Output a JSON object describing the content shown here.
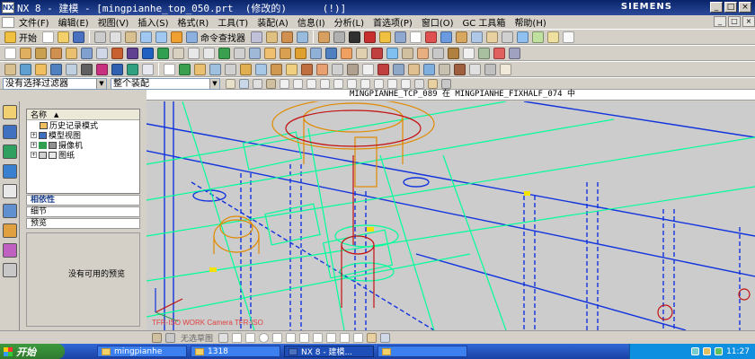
{
  "window": {
    "title": "NX 8 - 建模 - [mingpianhe_top_050.prt  (修改的)      (!)]",
    "brand": "SIEMENS",
    "minimize": "_",
    "restore": "□",
    "close": "×"
  },
  "menu": [
    "文件(F)",
    "编辑(E)",
    "视图(V)",
    "插入(S)",
    "格式(R)",
    "工具(T)",
    "装配(A)",
    "信息(I)",
    "分析(L)",
    "首选项(P)",
    "窗口(O)",
    "GC 工具箱",
    "帮助(H)"
  ],
  "toolbar1": {
    "start_label": "开始",
    "command_finder_label": "命令查找器"
  },
  "filter_bar": {
    "selection_filter": "没有选择过滤器",
    "scope": "整个装配"
  },
  "graphics": {
    "work_part_label": "MINGPIANHE_TCP_089 在 MINGPIANHE_FIXHALF_074 中",
    "view_triad_text": "TFR-ISO WORK Camera TFR-ISO"
  },
  "navigator": {
    "column_header": "名称",
    "nodes": [
      {
        "label": "历史记录模式"
      },
      {
        "label": "模型视图"
      },
      {
        "label": "摄像机"
      },
      {
        "label": "图纸"
      }
    ],
    "sections": {
      "dependencies": "相依性",
      "details": "细节",
      "preview": "预览"
    },
    "preview_empty": "没有可用的预览"
  },
  "bottombar": {
    "hint": "无选草图"
  },
  "taskbar": {
    "start": "开始",
    "tasks": [
      {
        "label": "mingpianhe"
      },
      {
        "label": "1318"
      },
      {
        "label": "NX 8 - 建模..."
      },
      {
        "label": ""
      }
    ],
    "clock": "11:27"
  },
  "colors": {
    "title_bar": "#0a246a",
    "graphics_bg": "#cecece",
    "wire_green": "#00ff99",
    "wire_blue": "#1133dd",
    "wire_orange": "#e08a00",
    "wire_red": "#c41010"
  }
}
